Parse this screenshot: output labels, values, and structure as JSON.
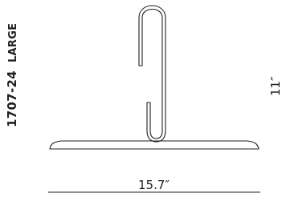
{
  "product": {
    "code": "1707-24",
    "size": "LARGE"
  },
  "dimensions": {
    "width": "15.7″",
    "height": "11″"
  },
  "colors": {
    "line": "#231f20"
  }
}
